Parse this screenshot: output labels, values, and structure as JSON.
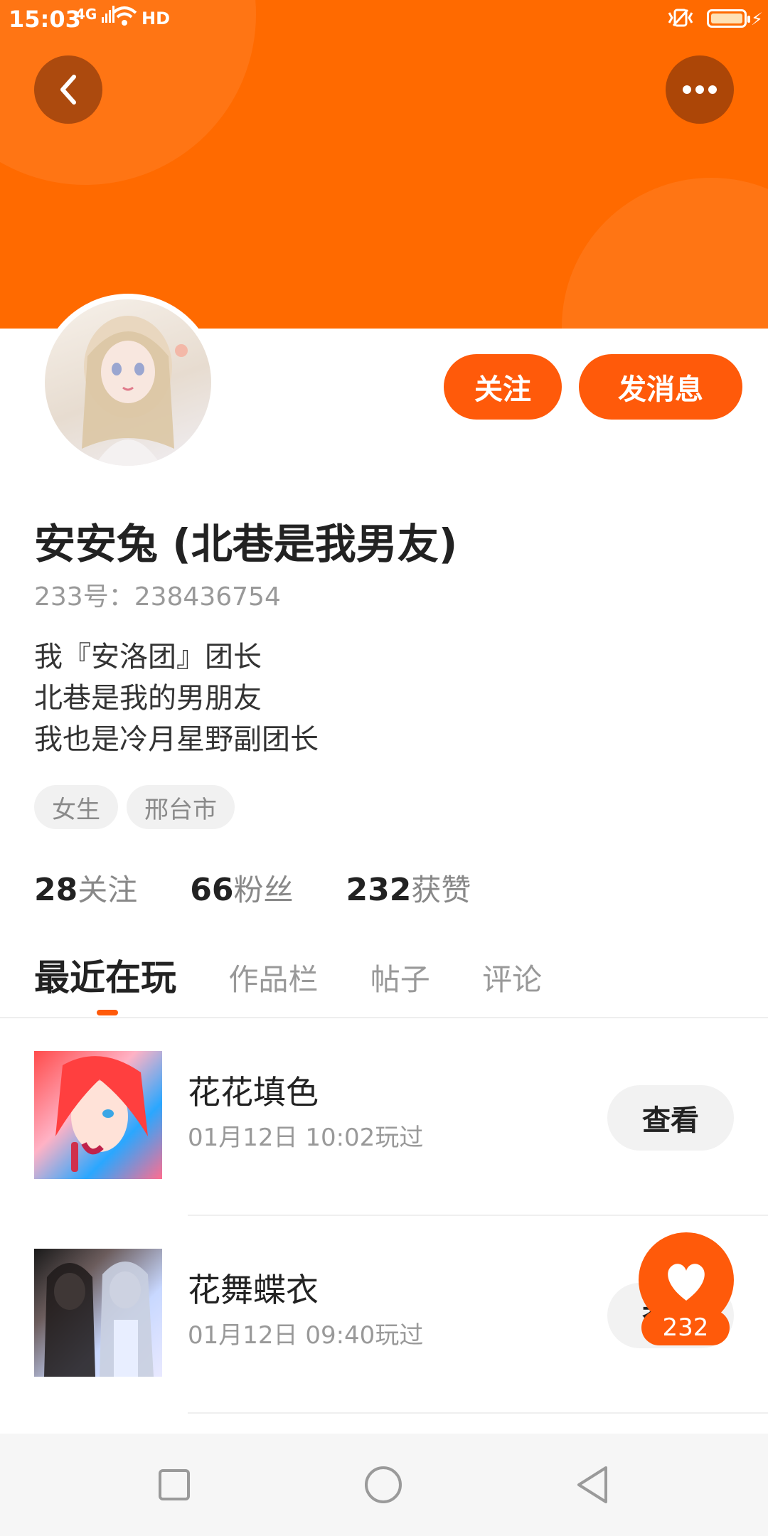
{
  "status_bar": {
    "time": "15:03",
    "signal": "4G",
    "hd": "HD"
  },
  "header": {
    "back_icon": "chevron-left-icon",
    "more_icon": "more-dots-icon",
    "banner_color": "#ff6a00"
  },
  "profile": {
    "name": "安安兔 (北巷是我男友)",
    "id_text": "233号：238436754",
    "bio": [
      "我『安洛团』团长",
      "北巷是我的男朋友",
      "我也是冷月星野副团长"
    ],
    "tags": [
      "女生",
      "邢台市"
    ],
    "buttons": {
      "follow": "关注",
      "message": "发消息"
    },
    "accent": "#ff5a0a"
  },
  "stats": [
    {
      "value": "28",
      "label": "关注"
    },
    {
      "value": "66",
      "label": "粉丝"
    },
    {
      "value": "232",
      "label": "获赞"
    }
  ],
  "tabs": [
    "最近在玩",
    "作品栏",
    "帖子",
    "评论"
  ],
  "games": [
    {
      "title": "花花填色",
      "time": "01月12日 10:02玩过",
      "action": "查看"
    },
    {
      "title": "花舞蝶衣",
      "time": "01月12日 09:40玩过",
      "action": "查看"
    }
  ],
  "fab": {
    "icon": "heart-icon",
    "count": "232"
  }
}
